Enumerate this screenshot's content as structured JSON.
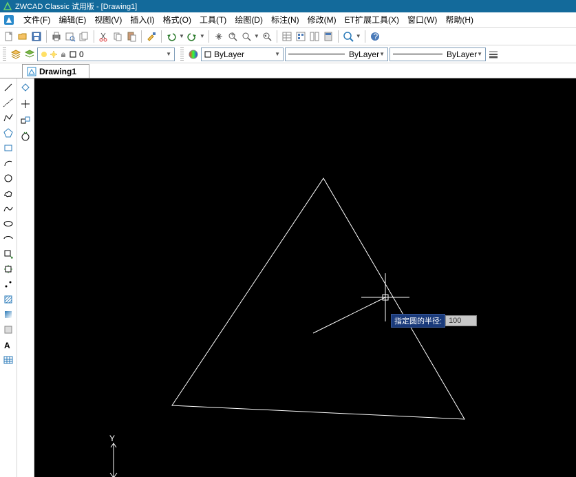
{
  "title": "ZWCAD Classic 试用版 - [Drawing1]",
  "menu": {
    "file": "文件(F)",
    "edit": "编辑(E)",
    "view": "视图(V)",
    "insert": "插入(I)",
    "format": "格式(O)",
    "tools": "工具(T)",
    "draw": "绘图(D)",
    "dim": "标注(N)",
    "modify": "修改(M)",
    "et": "ET扩展工具(X)",
    "window": "窗口(W)",
    "help": "帮助(H)"
  },
  "layer": {
    "current_state_label": "0",
    "bylayer_color": "ByLayer",
    "bylayer_ltype": "ByLayer",
    "bylayer_lweight": "ByLayer"
  },
  "tab": {
    "name": "Drawing1"
  },
  "dynamic_input": {
    "prompt": "指定圆的半径:",
    "value": "100"
  },
  "colors": {
    "titlebar": "#136a9b",
    "canvas_bg": "#000000",
    "geom": "#ffffff",
    "prompt_bg": "#1a3a7a"
  }
}
